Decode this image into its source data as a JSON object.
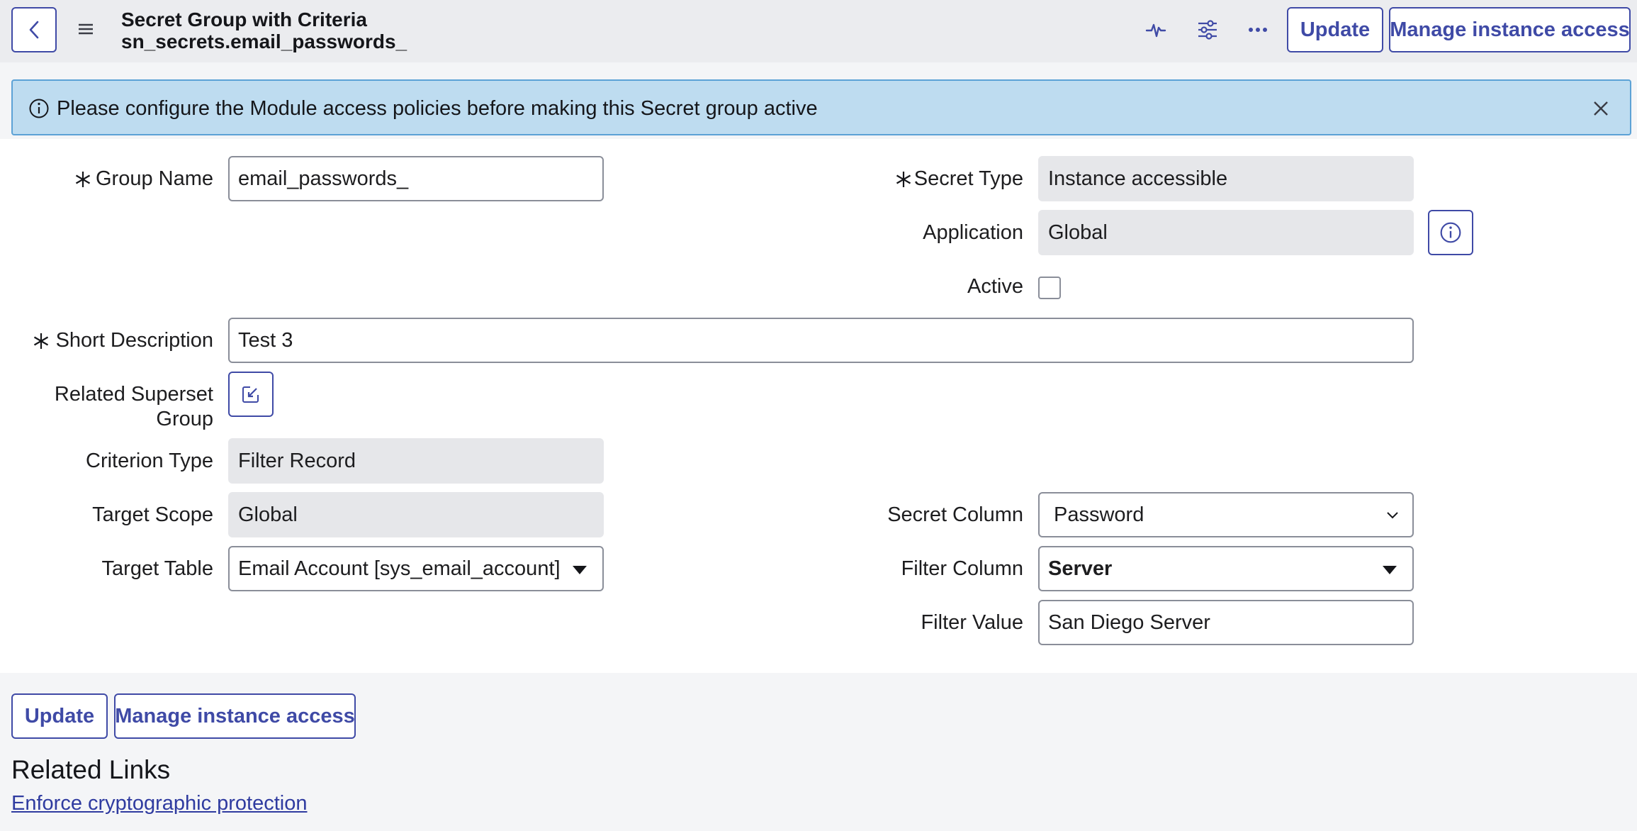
{
  "header": {
    "title": "Secret Group with Criteria",
    "subtitle": "sn_secrets.email_passwords_",
    "update_label": "Update",
    "manage_label": "Manage instance access",
    "icons": [
      "back-icon",
      "menu-icon",
      "activity-icon",
      "sliders-icon",
      "more-icon"
    ]
  },
  "banner": {
    "message": "Please configure the Module access policies before making this Secret group active",
    "icons": [
      "info-icon",
      "close-icon"
    ]
  },
  "form": {
    "group_name": {
      "label": "Group Name",
      "value": "email_passwords_",
      "required": true
    },
    "secret_type": {
      "label": "Secret Type",
      "value": "Instance accessible",
      "required": true
    },
    "application": {
      "label": "Application",
      "value": "Global"
    },
    "active": {
      "label": "Active",
      "checked": false
    },
    "short_description": {
      "label": "Short Description",
      "value": "Test 3",
      "required": true
    },
    "related_superset_group": {
      "label_line1": "Related Superset",
      "label_line2": "Group"
    },
    "criterion_type": {
      "label": "Criterion Type",
      "value": "Filter Record"
    },
    "target_scope": {
      "label": "Target Scope",
      "value": "Global"
    },
    "target_table": {
      "label": "Target Table",
      "value": "Email Account [sys_email_account]"
    },
    "secret_column": {
      "label": "Secret Column",
      "value": "Password"
    },
    "filter_column": {
      "label": "Filter Column",
      "value": "Server"
    },
    "filter_value": {
      "label": "Filter Value",
      "value": "San Diego Server"
    }
  },
  "footer": {
    "update_label": "Update",
    "manage_label": "Manage instance access",
    "related_links_title": "Related Links",
    "links": [
      {
        "label": "Enforce cryptographic protection"
      }
    ]
  },
  "colors": {
    "accent": "#3f4aa6",
    "banner_bg": "#bedcf0",
    "banner_border": "#5ca2d6",
    "header_bg": "#ebecef",
    "readonly_bg": "#e6e7ea"
  }
}
